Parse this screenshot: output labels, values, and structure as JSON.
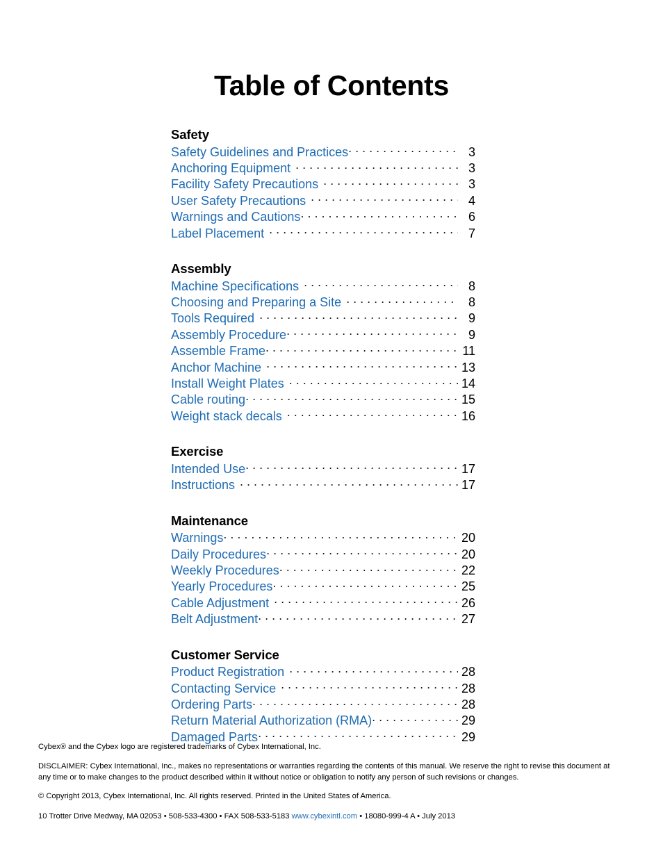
{
  "document": {
    "title": "Table of Contents"
  },
  "colors": {
    "entry_blue": "#1F6CB4",
    "leader_dots": "#1a1a1a",
    "heading_black": "#000000"
  },
  "toc": {
    "sections": [
      {
        "heading": "Safety",
        "entries": [
          {
            "label": "Safety Guidelines and Practices",
            "page": "3",
            "gap": false
          },
          {
            "label": "Anchoring Equipment",
            "page": "3",
            "gap": true
          },
          {
            "label": "Facility Safety Precautions",
            "page": "3",
            "gap": true
          },
          {
            "label": "User Safety Precautions",
            "page": "4",
            "gap": true
          },
          {
            "label": "Warnings and Cautions",
            "page": "6",
            "gap": false
          },
          {
            "label": "Label Placement",
            "page": "7",
            "gap": true
          }
        ]
      },
      {
        "heading": "Assembly",
        "entries": [
          {
            "label": "Machine Specifications",
            "page": "8",
            "gap": true
          },
          {
            "label": "Choosing and Preparing a Site",
            "page": "8",
            "gap": true
          },
          {
            "label": "Tools Required",
            "page": "9",
            "gap": true
          },
          {
            "label": "Assembly Procedure",
            "page": "9",
            "gap": false
          },
          {
            "label": "Assemble Frame",
            "page": "11",
            "gap": false
          },
          {
            "label": "Anchor Machine",
            "page": "13",
            "gap": true
          },
          {
            "label": "Install Weight Plates",
            "page": "14",
            "gap": true
          },
          {
            "label": "Cable routing",
            "page": "15",
            "gap": false
          },
          {
            "label": "Weight stack decals",
            "page": "16",
            "gap": true
          }
        ]
      },
      {
        "heading": "Exercise",
        "entries": [
          {
            "label": "Intended Use",
            "page": "17",
            "gap": false
          },
          {
            "label": "Instructions",
            "page": "17",
            "gap": true
          }
        ]
      },
      {
        "heading": "Maintenance",
        "entries": [
          {
            "label": "Warnings",
            "page": "20",
            "gap": false
          },
          {
            "label": "Daily Procedures",
            "page": "20",
            "gap": false
          },
          {
            "label": "Weekly Procedures",
            "page": "22",
            "gap": false
          },
          {
            "label": "Yearly Procedures",
            "page": "25",
            "gap": false
          },
          {
            "label": "Cable Adjustment",
            "page": "26",
            "gap": true
          },
          {
            "label": "Belt Adjustment",
            "page": "27",
            "gap": false
          }
        ]
      },
      {
        "heading": "Customer Service",
        "entries": [
          {
            "label": "Product Registration",
            "page": "28",
            "gap": true
          },
          {
            "label": "Contacting Service",
            "page": "28",
            "gap": true
          },
          {
            "label": "Ordering Parts",
            "page": "28",
            "gap": false
          },
          {
            "label": "Return Material Authorization (RMA)",
            "page": "29",
            "gap": false
          },
          {
            "label": "Damaged Parts",
            "page": "29",
            "gap": false
          }
        ]
      }
    ]
  },
  "footer": {
    "trademark": "Cybex® and the Cybex logo are registered trademarks of Cybex International, Inc.",
    "disclaimer": "DISCLAIMER: Cybex International, Inc., makes no representations or warranties regarding the contents of this manual. We reserve the right to revise this document at any time or to make changes to the product described within it without notice or obligation to notify any person of such revisions or changes.",
    "copyright": "© Copyright 2013, Cybex International, Inc. All rights reserved. Printed in the United States of America.",
    "address_before_link": "10 Trotter Drive Medway, MA 02053 • 508-533-4300 • FAX 508-533-5183 ",
    "address_link": "www.cybexintl.com",
    "address_after_link": " • 18080-999-4 A • July 2013"
  }
}
